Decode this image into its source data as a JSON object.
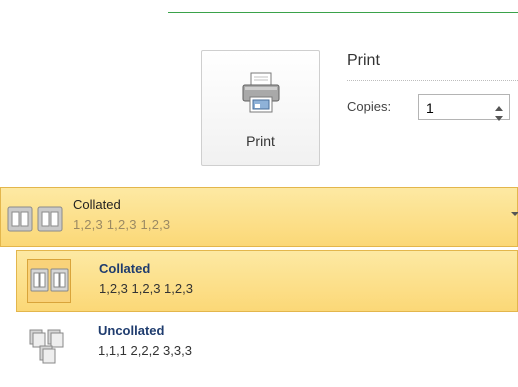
{
  "print_section": {
    "button_label": "Print",
    "header": "Print",
    "copies_label": "Copies:",
    "copies_value": "1"
  },
  "collation": {
    "selected": {
      "title": "Collated",
      "detail": "1,2,3   1,2,3   1,2,3"
    },
    "options": [
      {
        "title": "Collated",
        "detail": "1,2,3   1,2,3   1,2,3"
      },
      {
        "title": "Uncollated",
        "detail": "1,1,1   2,2,2   3,3,3"
      }
    ]
  },
  "colors": {
    "accent_line": "#3aa24a",
    "highlight_fill": "#fbd877",
    "highlight_border": "#e3b64c",
    "option_title": "#1f3c6e"
  },
  "icons": {
    "print_button": "printer-icon",
    "collated": "collated-pages-icon",
    "uncollated": "uncollated-pages-icon"
  }
}
